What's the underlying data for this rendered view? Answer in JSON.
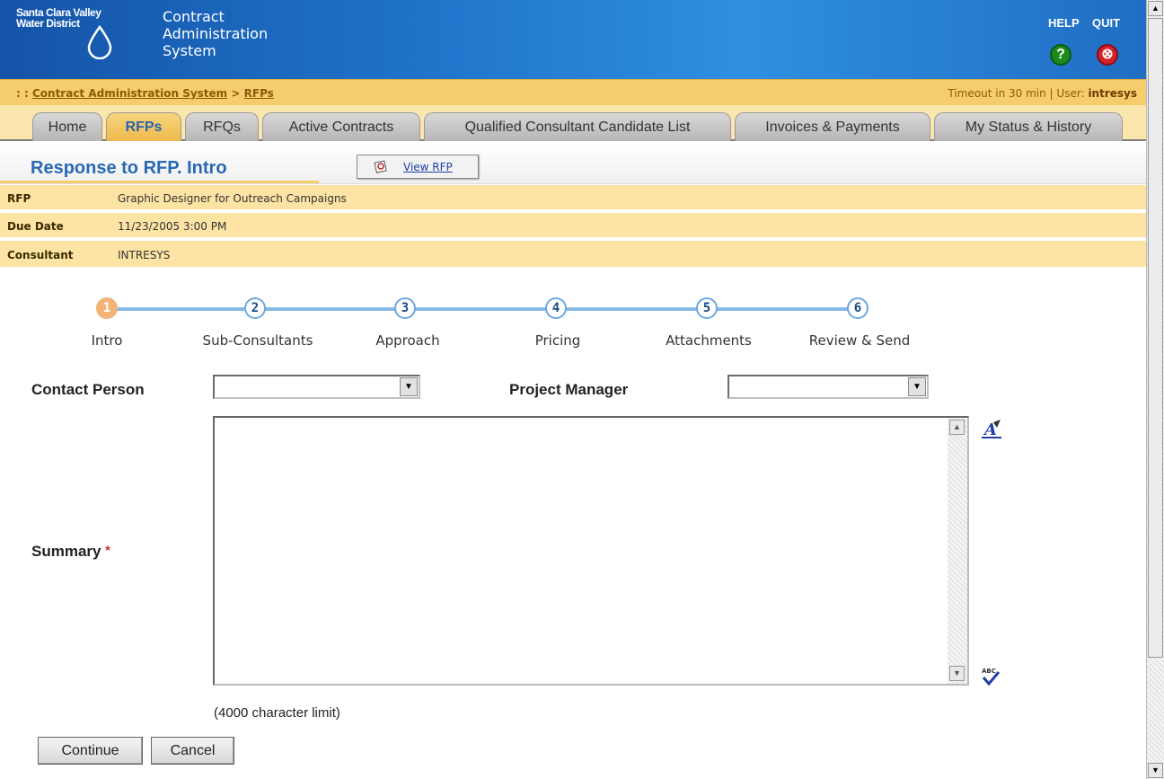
{
  "header": {
    "org_name": "Santa Clara Valley Water District",
    "app_title": "Contract Administration System",
    "help_label": "HELP",
    "quit_label": "QUIT",
    "help_icon": "?",
    "quit_icon": "⊗"
  },
  "breadcrumb": {
    "prefix": ": :",
    "root": "Contract Administration System",
    "separator": ">",
    "current": "RFPs"
  },
  "session": {
    "timeout": "Timeout in 30 min",
    "separator": "|",
    "user_label": "User:",
    "user_name": "intresys"
  },
  "tabs": [
    {
      "label": "Home",
      "active": false
    },
    {
      "label": "RFPs",
      "active": true
    },
    {
      "label": "RFQs",
      "active": false
    },
    {
      "label": "Active Contracts",
      "active": false
    },
    {
      "label": "Qualified Consultant Candidate List",
      "active": false
    },
    {
      "label": "Invoices & Payments",
      "active": false
    },
    {
      "label": "My Status & History",
      "active": false
    }
  ],
  "page": {
    "title": "Response to RFP. Intro",
    "view_rfp_label": "View RFP"
  },
  "info": {
    "rfp_label": "RFP",
    "rfp_value": "Graphic Designer for Outreach Campaigns",
    "due_label": "Due Date",
    "due_value": "11/23/2005 3:00 PM",
    "consultant_label": "Consultant",
    "consultant_value": "INTRESYS"
  },
  "steps": [
    {
      "number": "1",
      "label": "Intro",
      "active": true
    },
    {
      "number": "2",
      "label": "Sub-Consultants",
      "active": false
    },
    {
      "number": "3",
      "label": "Approach",
      "active": false
    },
    {
      "number": "4",
      "label": "Pricing",
      "active": false
    },
    {
      "number": "5",
      "label": "Attachments",
      "active": false
    },
    {
      "number": "6",
      "label": "Review & Send",
      "active": false
    }
  ],
  "form": {
    "contact_label": "Contact Person",
    "contact_value": "",
    "manager_label": "Project Manager",
    "manager_value": "",
    "summary_label": "Summary",
    "required_mark": "*",
    "summary_value": "",
    "char_limit": "(4000 character limit)",
    "continue_label": "Continue",
    "cancel_label": "Cancel"
  },
  "colors": {
    "header_blue": "#1e72c8",
    "breadcrumb_gold": "#f6cd6c",
    "info_row": "#fde3a4",
    "active_tab": "#eeb94b",
    "step_active": "#f3b478",
    "step_line": "#88b8e4"
  }
}
